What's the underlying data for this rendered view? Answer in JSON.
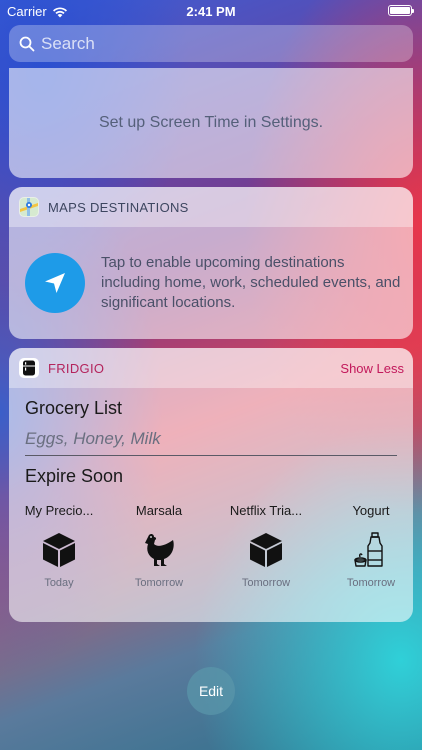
{
  "status_bar": {
    "carrier": "Carrier",
    "time": "2:41 PM",
    "icons": [
      "wifi-icon",
      "battery-icon"
    ]
  },
  "search": {
    "placeholder": "Search",
    "value": ""
  },
  "screen_time": {
    "message": "Set up Screen Time in Settings."
  },
  "maps": {
    "title": "MAPS DESTINATIONS",
    "icon": "maps-app-icon",
    "message": "Tap to enable upcoming destinations including home, work, scheduled events, and significant locations.",
    "action_icon": "navigation-arrow-icon",
    "accent": "#1e9be8"
  },
  "fridgio": {
    "title": "FRIDGIO",
    "icon": "fridge-app-icon",
    "show_less_label": "Show Less",
    "accent": "#c2185b",
    "grocery": {
      "heading": "Grocery List",
      "items": "Eggs, Honey, Milk"
    },
    "expire": {
      "heading": "Expire Soon",
      "items": [
        {
          "name": "My Precio...",
          "icon": "box-icon",
          "when": "Today"
        },
        {
          "name": "Marsala",
          "icon": "chicken-icon",
          "when": "Tomorrow"
        },
        {
          "name": "Netflix Tria...",
          "icon": "box-icon",
          "when": "Tomorrow"
        },
        {
          "name": "Yogurt",
          "icon": "dairy-icon",
          "when": "Tomorrow"
        }
      ]
    }
  },
  "edit_label": "Edit"
}
